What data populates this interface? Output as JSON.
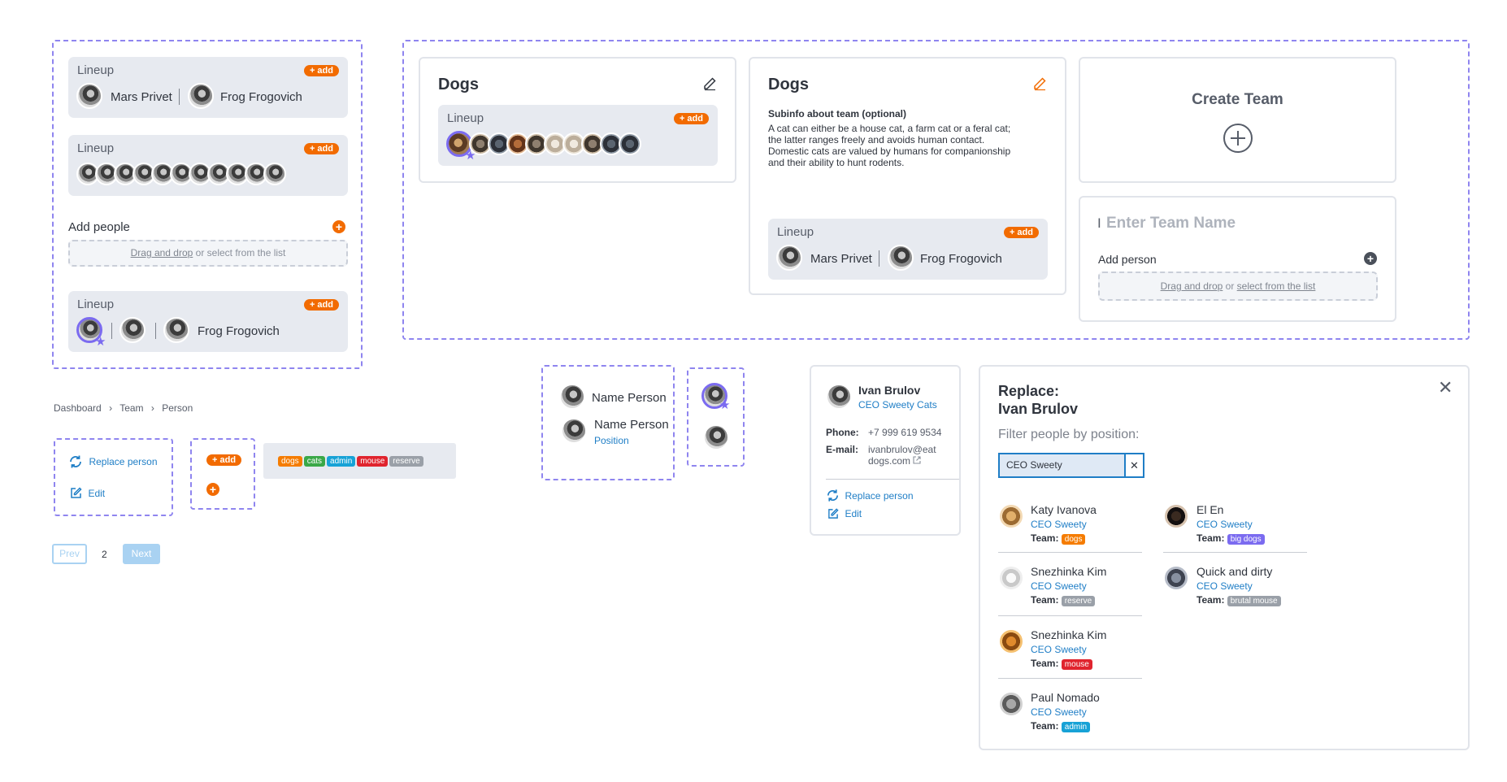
{
  "lineup_label": "Lineup",
  "add_label": "+ add",
  "people": {
    "mars": "Mars Privet",
    "frog": "Frog Frogovich"
  },
  "add_people": {
    "title": "Add people",
    "drag_text": "Drag and drop",
    "or_text": " or select from the list"
  },
  "breadcrumb": [
    "Dashboard",
    "Team",
    "Person"
  ],
  "person_actions": {
    "replace": "Replace person",
    "edit": "Edit"
  },
  "tags": [
    {
      "label": "dogs",
      "color": "#f57c00"
    },
    {
      "label": "cats",
      "color": "#3aa848"
    },
    {
      "label": "admin",
      "color": "#17a2d6"
    },
    {
      "label": "mouse",
      "color": "#e0242e"
    },
    {
      "label": "reserve",
      "color": "#9aa0a8"
    }
  ],
  "pagination": {
    "prev": "Prev",
    "page": "2",
    "next": "Next"
  },
  "team1": {
    "title": "Dogs"
  },
  "team2": {
    "title": "Dogs",
    "subtitle": "Subinfo about team (optional)",
    "description": "A cat can either be a house cat, a farm cat or a feral cat; the latter ranges freely and avoids human contact. Domestic cats are valued by humans for companionship and their ability to hunt rodents."
  },
  "create_team": {
    "title": "Create Team"
  },
  "new_team": {
    "placeholder": "Enter Team Name",
    "add_person": "Add person",
    "drag_text": "Drag and drop",
    "or_text": " or ",
    "select_text": "select from the list"
  },
  "name_person": {
    "name1": "Name Person",
    "name2": "Name Person",
    "position": "Position"
  },
  "profile": {
    "name": "Ivan Brulov",
    "role": "CEO Sweety Cats",
    "phone_label": "Phone:",
    "phone": "+7 999 619 9534",
    "email_label": "E-mail:",
    "email_line1": "ivanbrulov@eat",
    "email_line2": "dogs.com",
    "replace": "Replace person",
    "edit": "Edit"
  },
  "replace_panel": {
    "title": "Replace:",
    "name": "Ivan Brulov",
    "filter_label": "Filter people by position:",
    "filter_value": "CEO Sweety",
    "team_label": "Team:",
    "results": [
      {
        "name": "Katy Ivanova",
        "position": "CEO Sweety",
        "team": "dogs",
        "team_color": "#f57c00"
      },
      {
        "name": "El En",
        "position": "CEO Sweety",
        "team": "big dogs",
        "team_color": "#7b6bf0"
      },
      {
        "name": "Snezhinka Kim",
        "position": "CEO Sweety",
        "team": "reserve",
        "team_color": "#9aa0a8"
      },
      {
        "name": "Quick and dirty",
        "position": "CEO Sweety",
        "team": "brutal mouse",
        "team_color": "#9aa0a8"
      },
      {
        "name": "Snezhinka Kim",
        "position": "CEO Sweety",
        "team": "mouse",
        "team_color": "#e0242e"
      },
      {
        "name": "Paul Nomado",
        "position": "CEO Sweety",
        "team": "admin",
        "team_color": "#17a2d6"
      }
    ]
  },
  "colors": {
    "accent": "#f26b00",
    "purple": "#7b6bf0",
    "link": "#1f7ec6"
  }
}
